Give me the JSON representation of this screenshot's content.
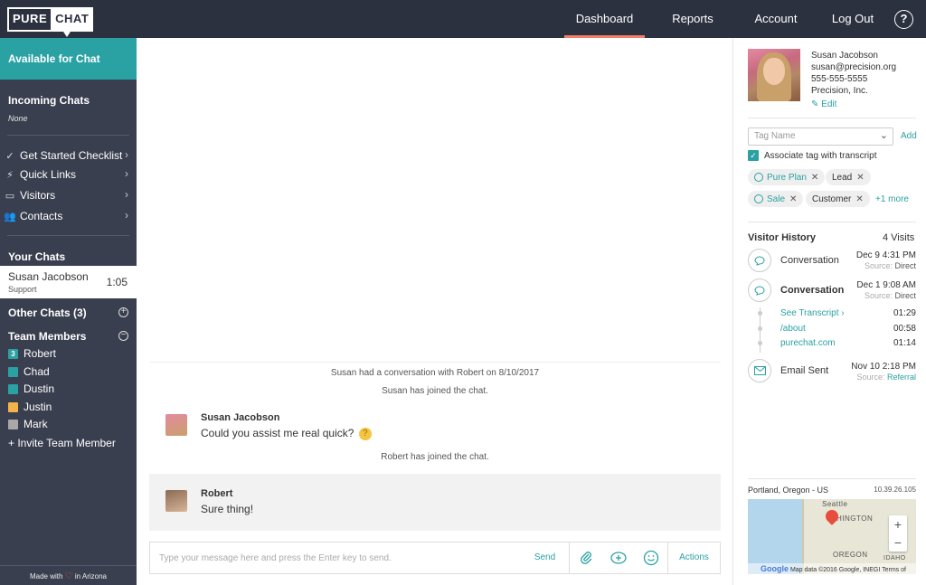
{
  "logo": {
    "part1": "PURE",
    "part2": "CHAT"
  },
  "nav": [
    {
      "label": "Dashboard"
    },
    {
      "label": "Reports"
    },
    {
      "label": "Account"
    },
    {
      "label": "Log Out"
    }
  ],
  "help_glyph": "?",
  "sidebar": {
    "status": "Available for Chat",
    "incoming_title": "Incoming Chats",
    "incoming_value": "None",
    "links": [
      {
        "label": "Get Started Checklist",
        "icon": "check-icon"
      },
      {
        "label": "Quick Links",
        "icon": "bolt-icon"
      },
      {
        "label": "Visitors",
        "icon": "monitor-icon"
      },
      {
        "label": "Contacts",
        "icon": "people-icon"
      }
    ],
    "your_chats_title": "Your Chats",
    "your_chat": {
      "name": "Susan Jacobson",
      "dept": "Support",
      "time": "1:05"
    },
    "other_chats": "Other Chats (3)",
    "team_title": "Team Members",
    "members": [
      {
        "name": "Robert",
        "color": "#2aa1a3",
        "badge": "3"
      },
      {
        "name": "Chad",
        "color": "#2aa1a3",
        "badge": ""
      },
      {
        "name": "Dustin",
        "color": "#2aa1a3",
        "badge": ""
      },
      {
        "name": "Justin",
        "color": "#f0b44a",
        "badge": ""
      },
      {
        "name": "Mark",
        "color": "#a8a8a8",
        "badge": ""
      }
    ],
    "invite": "+ Invite Team Member",
    "made_prefix": "Made with",
    "made_suffix": "in Arizona"
  },
  "chat": {
    "history_note": "Susan had a conversation with Robert on 8/10/2017",
    "joined_susan": "Susan has joined the chat.",
    "msg1_author": "Susan Jacobson",
    "msg1_text": "Could you assist me real quick?",
    "joined_robert": "Robert has joined the chat.",
    "msg2_author": "Robert",
    "msg2_text": "Sure thing!",
    "placeholder": "Type your message here and press the Enter key to send.",
    "send": "Send",
    "actions": "Actions"
  },
  "contact": {
    "name": "Susan Jacobson",
    "email": "susan@precision.org",
    "phone": "555-555-5555",
    "company": "Precision, Inc.",
    "edit": "Edit"
  },
  "tags": {
    "placeholder": "Tag Name",
    "add": "Add",
    "associate": "Associate tag with transcript",
    "items": [
      "Pure Plan",
      "Lead",
      "Sale",
      "Customer"
    ],
    "more": "+1 more"
  },
  "history": {
    "title": "Visitor History",
    "count": "4 Visits",
    "source_label": "Source:",
    "entries": [
      {
        "label": "Conversation",
        "date": "Dec 9 4:31 PM",
        "source": "Direct"
      },
      {
        "label": "Conversation",
        "date": "Dec 1 9:08 AM",
        "source": "Direct"
      },
      {
        "label": "Email Sent",
        "date": "Nov 10 2:18 PM",
        "source": "Referral"
      }
    ],
    "pages": [
      {
        "label": "See Transcript ›",
        "time": "01:29"
      },
      {
        "label": "/about",
        "time": "00:58"
      },
      {
        "label": "purechat.com",
        "time": "01:14"
      }
    ]
  },
  "location": {
    "place": "Portland, Oregon - US",
    "ip": "10.39.26.105",
    "map_labels": [
      "Seattle",
      "HINGTON",
      "OREGON",
      "IDAHO"
    ],
    "map_footer": "Map data ©2016 Google, INEGI   Terms of Use",
    "google": "Google"
  }
}
